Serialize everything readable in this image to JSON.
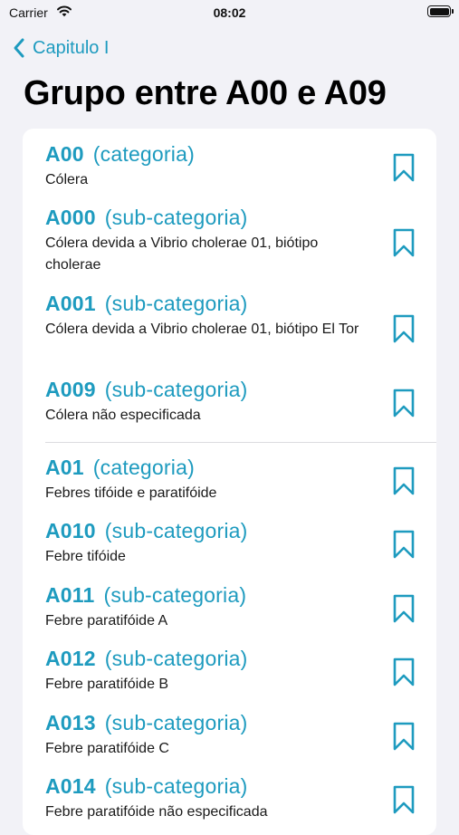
{
  "status_bar": {
    "carrier": "Carrier",
    "time": "08:02"
  },
  "nav": {
    "back_label": "Capitulo I"
  },
  "title": "Grupo entre A00 e A09",
  "colors": {
    "accent": "#1e9bbf",
    "background": "#f2f2f7",
    "card": "#ffffff"
  },
  "items": [
    {
      "code": "A00",
      "type": "(categoria)",
      "description": "Cólera"
    },
    {
      "code": "A000",
      "type": "(sub-categoria)",
      "description": "Cólera devida a Vibrio cholerae 01, biótipo cholerae"
    },
    {
      "code": "A001",
      "type": "(sub-categoria)",
      "description": "Cólera devida a Vibrio cholerae 01, biótipo El Tor"
    },
    {
      "code": "A009",
      "type": "(sub-categoria)",
      "description": "Cólera não especificada"
    },
    {
      "code": "A01",
      "type": "(categoria)",
      "description": "Febres tifóide e paratifóide"
    },
    {
      "code": "A010",
      "type": "(sub-categoria)",
      "description": "Febre tifóide"
    },
    {
      "code": "A011",
      "type": "(sub-categoria)",
      "description": "Febre paratifóide A"
    },
    {
      "code": "A012",
      "type": "(sub-categoria)",
      "description": "Febre paratifóide B"
    },
    {
      "code": "A013",
      "type": "(sub-categoria)",
      "description": "Febre paratifóide C"
    },
    {
      "code": "A014",
      "type": "(sub-categoria)",
      "description": "Febre paratifóide não especificada"
    }
  ],
  "icons": {
    "back": "chevron-left-icon",
    "row_action": "bookmark-icon"
  }
}
